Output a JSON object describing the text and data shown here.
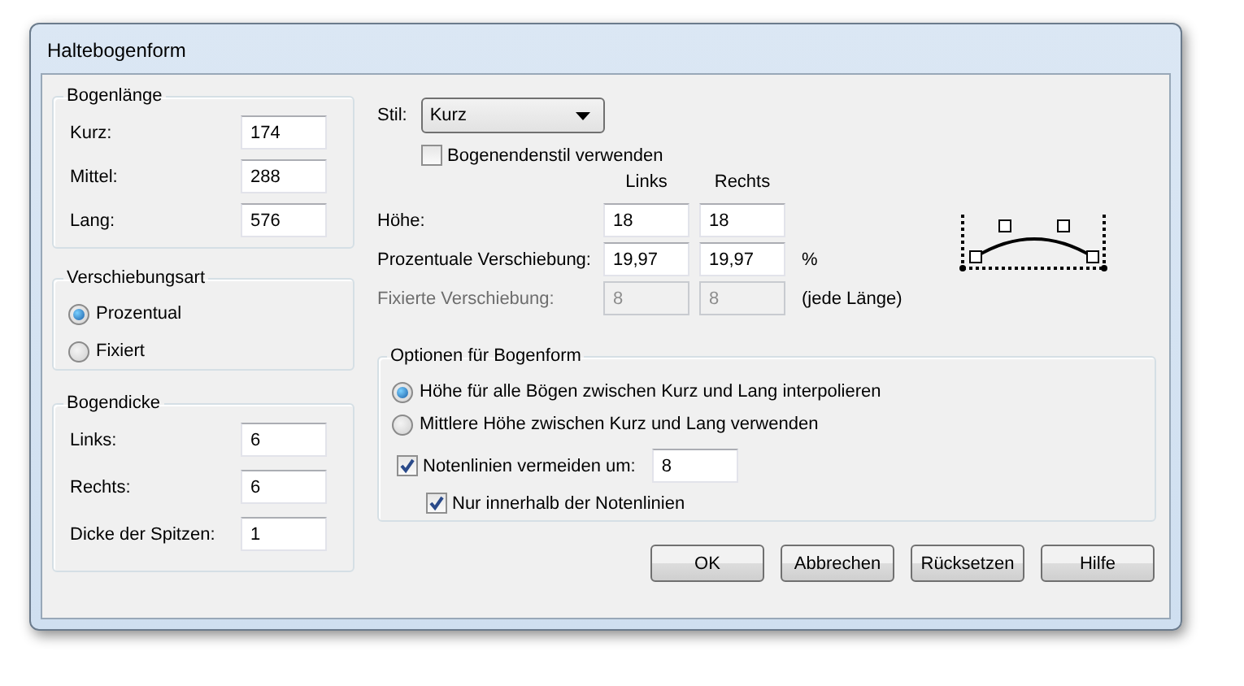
{
  "window": {
    "title": "Haltebogenform"
  },
  "bogenlaenge": {
    "title": "Bogenlänge",
    "fields": [
      {
        "label": "Kurz:",
        "value": "174"
      },
      {
        "label": "Mittel:",
        "value": "288"
      },
      {
        "label": "Lang:",
        "value": "576"
      }
    ]
  },
  "verschiebungsart": {
    "title": "Verschiebungsart",
    "options": [
      {
        "label": "Prozentual",
        "selected": true
      },
      {
        "label": "Fixiert",
        "selected": false
      }
    ]
  },
  "bogendicke": {
    "title": "Bogendicke",
    "fields": [
      {
        "label": "Links:",
        "value": "6"
      },
      {
        "label": "Rechts:",
        "value": "6"
      },
      {
        "label": "Dicke der Spitzen:",
        "value": "1"
      }
    ]
  },
  "stil": {
    "label": "Stil:",
    "value": "Kurz"
  },
  "bogenendenstil": {
    "label": "Bogenendenstil verwenden",
    "checked": false
  },
  "columns": [
    "Links",
    "Rechts"
  ],
  "rows": [
    {
      "label": "Höhe:",
      "values": [
        "18",
        "18"
      ],
      "disabled": false
    },
    {
      "label": "Prozentuale Verschiebung:",
      "values": [
        "19,97",
        "19,97"
      ],
      "unit": "%",
      "disabled": false
    },
    {
      "label": "Fixierte Verschiebung:",
      "values": [
        "8",
        "8"
      ],
      "unit": "(jede Länge)",
      "disabled": true
    }
  ],
  "optionen": {
    "title": "Optionen für Bogenform",
    "options": [
      {
        "label": "Höhe für alle Bögen zwischen Kurz und Lang interpolieren",
        "selected": true
      },
      {
        "label": "Mittlere Höhe zwischen Kurz und Lang verwenden",
        "selected": false
      }
    ],
    "avoid": {
      "label": "Notenlinien vermeiden um:",
      "checked": true,
      "value": "8"
    },
    "inside": {
      "label": "Nur innerhalb der Notenlinien",
      "checked": true
    }
  },
  "buttons": [
    "OK",
    "Abbrechen",
    "Rücksetzen",
    "Hilfe"
  ]
}
